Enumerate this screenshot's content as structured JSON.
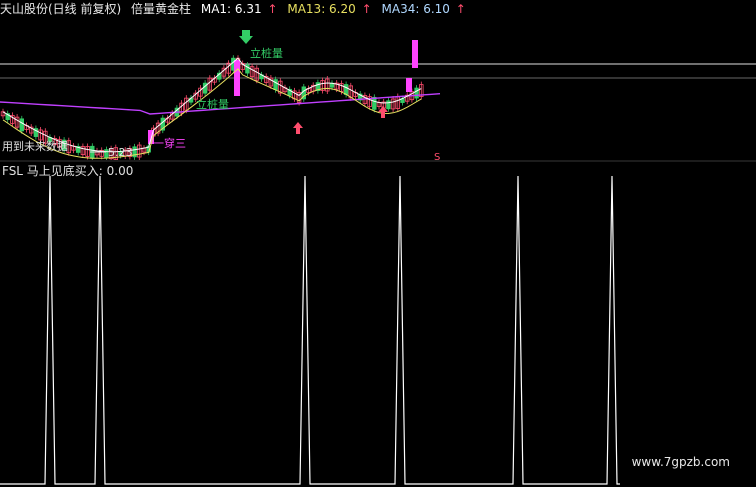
{
  "header": {
    "stock": "天山股份(日线 前复权)",
    "indicator": "倍量黄金柱",
    "ma1_label": "MA1: 6.31",
    "ma13_label": "MA13: 6.20",
    "ma34_label": "MA34: 6.10",
    "arrow": "↑"
  },
  "annotations": {
    "zhizhuangliang_top": "立桩量",
    "zhizhuangliang_mid": "立桩量",
    "future_data_note": "用到未来数据",
    "low_price": "5.23",
    "yichuansan": "一穿三",
    "s_marker": "S"
  },
  "bottom": {
    "label": "FSL  马上见底买入: 0.00"
  },
  "watermark": "www.7gpzb.com",
  "colors": {
    "up": "#ff4d6d",
    "down": "#33cc66",
    "ma1": "#ffffff",
    "ma13": "#e8e060",
    "ma34": "#c040ff",
    "gold_bar": "#ff44ff",
    "fsl_line": "#ffffff"
  },
  "chart_data": [
    {
      "type": "candlestick",
      "title": "天山股份(日线 前复权)",
      "series": [
        {
          "name": "MA1",
          "value": 6.31
        },
        {
          "name": "MA13",
          "value": 6.2
        },
        {
          "name": "MA34",
          "value": 6.1
        }
      ],
      "annotations": [
        "立桩量",
        "立桩量",
        "一穿三",
        "用到未来数据",
        "5.23",
        "S"
      ]
    },
    {
      "type": "line",
      "title": "FSL 马上见底买入: 0.00",
      "series": [
        {
          "name": "马上见底买入",
          "last_value": 0.0
        }
      ],
      "spikes_x": [
        50,
        100,
        305,
        400,
        518,
        612
      ]
    }
  ]
}
